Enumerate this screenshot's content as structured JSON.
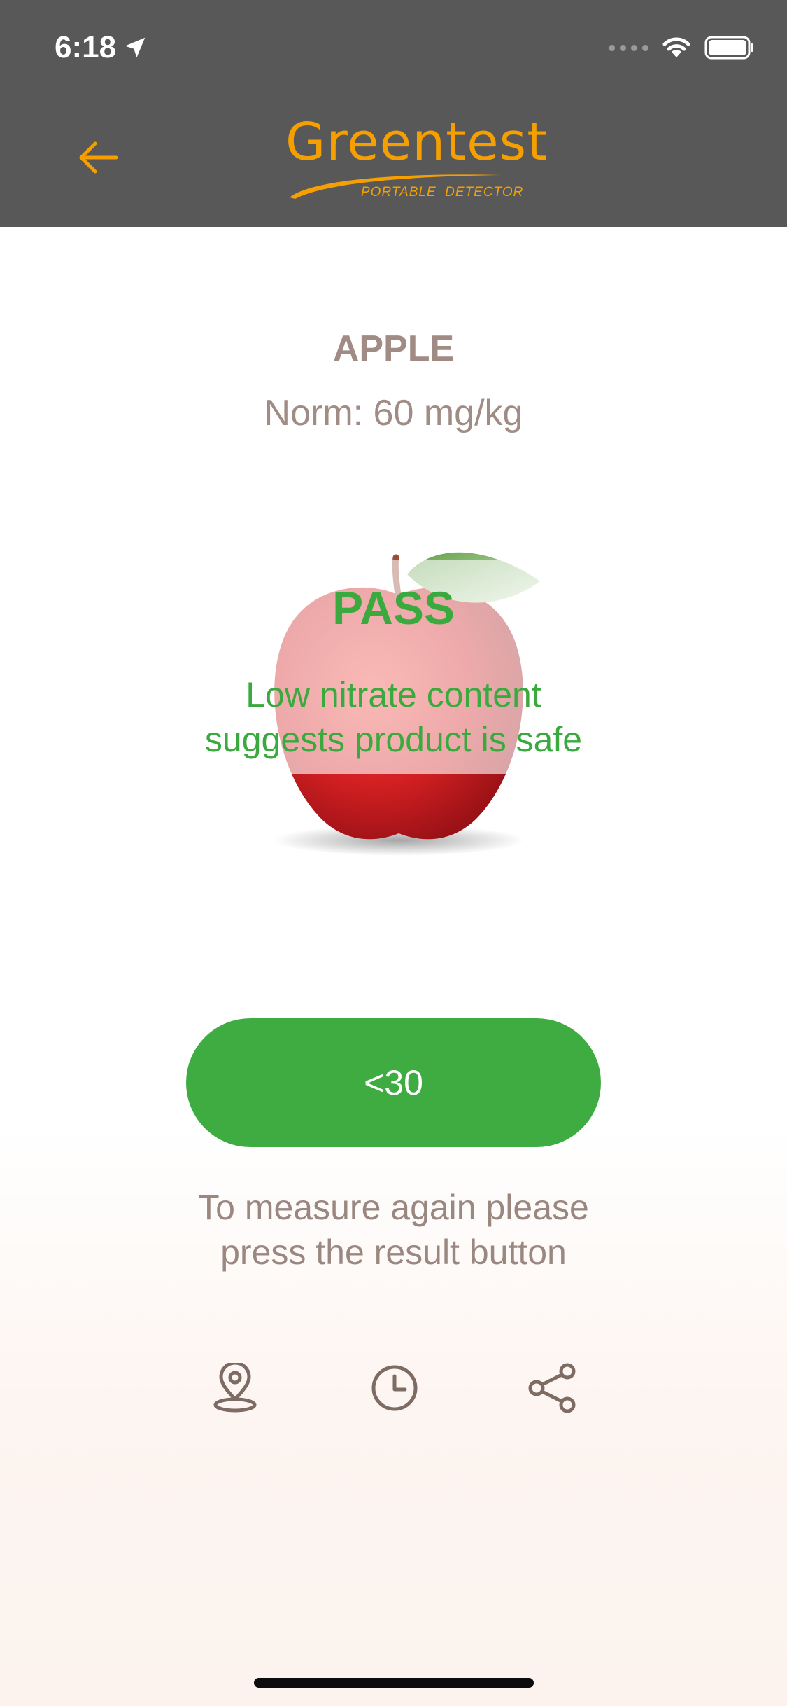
{
  "status_bar": {
    "time": "6:18"
  },
  "header": {
    "logo_title": "Greentest",
    "logo_subtitle": "PORTABLE  DETECTOR"
  },
  "product": {
    "name": "APPLE",
    "norm": "Norm: 60 mg/kg"
  },
  "result": {
    "status": "PASS",
    "message_line1": "Low nitrate content",
    "message_line2": "suggests product is safe",
    "value": "<30"
  },
  "hint": {
    "line1": "To measure again please",
    "line2": "press the result button"
  },
  "actions": {
    "icons": [
      "location-pin-icon",
      "clock-icon",
      "share-icon"
    ]
  },
  "colors": {
    "header_bg": "#585858",
    "brand_orange": "#f5a000",
    "pass_green": "#3aaa3e",
    "muted_text": "#a08c84"
  }
}
